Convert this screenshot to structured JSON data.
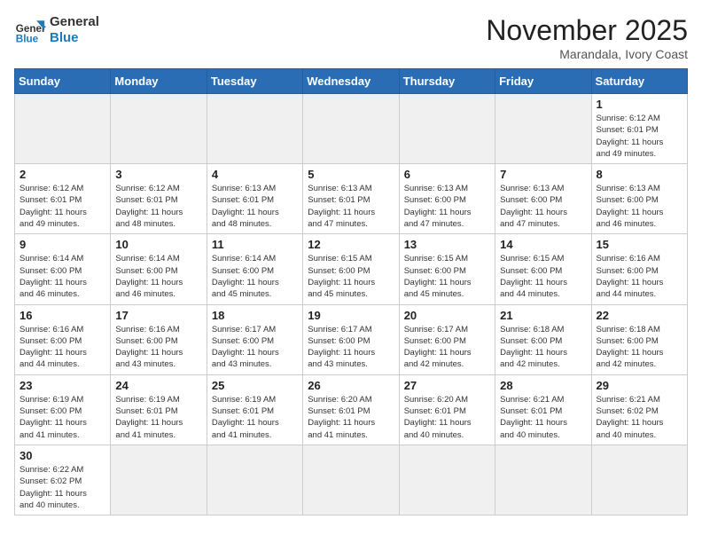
{
  "header": {
    "logo_general": "General",
    "logo_blue": "Blue",
    "month_title": "November 2025",
    "location": "Marandala, Ivory Coast"
  },
  "weekdays": [
    "Sunday",
    "Monday",
    "Tuesday",
    "Wednesday",
    "Thursday",
    "Friday",
    "Saturday"
  ],
  "weeks": [
    [
      {
        "day": "",
        "info": ""
      },
      {
        "day": "",
        "info": ""
      },
      {
        "day": "",
        "info": ""
      },
      {
        "day": "",
        "info": ""
      },
      {
        "day": "",
        "info": ""
      },
      {
        "day": "",
        "info": ""
      },
      {
        "day": "1",
        "info": "Sunrise: 6:12 AM\nSunset: 6:01 PM\nDaylight: 11 hours\nand 49 minutes."
      }
    ],
    [
      {
        "day": "2",
        "info": "Sunrise: 6:12 AM\nSunset: 6:01 PM\nDaylight: 11 hours\nand 49 minutes."
      },
      {
        "day": "3",
        "info": "Sunrise: 6:12 AM\nSunset: 6:01 PM\nDaylight: 11 hours\nand 48 minutes."
      },
      {
        "day": "4",
        "info": "Sunrise: 6:13 AM\nSunset: 6:01 PM\nDaylight: 11 hours\nand 48 minutes."
      },
      {
        "day": "5",
        "info": "Sunrise: 6:13 AM\nSunset: 6:01 PM\nDaylight: 11 hours\nand 47 minutes."
      },
      {
        "day": "6",
        "info": "Sunrise: 6:13 AM\nSunset: 6:00 PM\nDaylight: 11 hours\nand 47 minutes."
      },
      {
        "day": "7",
        "info": "Sunrise: 6:13 AM\nSunset: 6:00 PM\nDaylight: 11 hours\nand 47 minutes."
      },
      {
        "day": "8",
        "info": "Sunrise: 6:13 AM\nSunset: 6:00 PM\nDaylight: 11 hours\nand 46 minutes."
      }
    ],
    [
      {
        "day": "9",
        "info": "Sunrise: 6:14 AM\nSunset: 6:00 PM\nDaylight: 11 hours\nand 46 minutes."
      },
      {
        "day": "10",
        "info": "Sunrise: 6:14 AM\nSunset: 6:00 PM\nDaylight: 11 hours\nand 46 minutes."
      },
      {
        "day": "11",
        "info": "Sunrise: 6:14 AM\nSunset: 6:00 PM\nDaylight: 11 hours\nand 45 minutes."
      },
      {
        "day": "12",
        "info": "Sunrise: 6:15 AM\nSunset: 6:00 PM\nDaylight: 11 hours\nand 45 minutes."
      },
      {
        "day": "13",
        "info": "Sunrise: 6:15 AM\nSunset: 6:00 PM\nDaylight: 11 hours\nand 45 minutes."
      },
      {
        "day": "14",
        "info": "Sunrise: 6:15 AM\nSunset: 6:00 PM\nDaylight: 11 hours\nand 44 minutes."
      },
      {
        "day": "15",
        "info": "Sunrise: 6:16 AM\nSunset: 6:00 PM\nDaylight: 11 hours\nand 44 minutes."
      }
    ],
    [
      {
        "day": "16",
        "info": "Sunrise: 6:16 AM\nSunset: 6:00 PM\nDaylight: 11 hours\nand 44 minutes."
      },
      {
        "day": "17",
        "info": "Sunrise: 6:16 AM\nSunset: 6:00 PM\nDaylight: 11 hours\nand 43 minutes."
      },
      {
        "day": "18",
        "info": "Sunrise: 6:17 AM\nSunset: 6:00 PM\nDaylight: 11 hours\nand 43 minutes."
      },
      {
        "day": "19",
        "info": "Sunrise: 6:17 AM\nSunset: 6:00 PM\nDaylight: 11 hours\nand 43 minutes."
      },
      {
        "day": "20",
        "info": "Sunrise: 6:17 AM\nSunset: 6:00 PM\nDaylight: 11 hours\nand 42 minutes."
      },
      {
        "day": "21",
        "info": "Sunrise: 6:18 AM\nSunset: 6:00 PM\nDaylight: 11 hours\nand 42 minutes."
      },
      {
        "day": "22",
        "info": "Sunrise: 6:18 AM\nSunset: 6:00 PM\nDaylight: 11 hours\nand 42 minutes."
      }
    ],
    [
      {
        "day": "23",
        "info": "Sunrise: 6:19 AM\nSunset: 6:00 PM\nDaylight: 11 hours\nand 41 minutes."
      },
      {
        "day": "24",
        "info": "Sunrise: 6:19 AM\nSunset: 6:01 PM\nDaylight: 11 hours\nand 41 minutes."
      },
      {
        "day": "25",
        "info": "Sunrise: 6:19 AM\nSunset: 6:01 PM\nDaylight: 11 hours\nand 41 minutes."
      },
      {
        "day": "26",
        "info": "Sunrise: 6:20 AM\nSunset: 6:01 PM\nDaylight: 11 hours\nand 41 minutes."
      },
      {
        "day": "27",
        "info": "Sunrise: 6:20 AM\nSunset: 6:01 PM\nDaylight: 11 hours\nand 40 minutes."
      },
      {
        "day": "28",
        "info": "Sunrise: 6:21 AM\nSunset: 6:01 PM\nDaylight: 11 hours\nand 40 minutes."
      },
      {
        "day": "29",
        "info": "Sunrise: 6:21 AM\nSunset: 6:02 PM\nDaylight: 11 hours\nand 40 minutes."
      }
    ],
    [
      {
        "day": "30",
        "info": "Sunrise: 6:22 AM\nSunset: 6:02 PM\nDaylight: 11 hours\nand 40 minutes."
      },
      {
        "day": "",
        "info": ""
      },
      {
        "day": "",
        "info": ""
      },
      {
        "day": "",
        "info": ""
      },
      {
        "day": "",
        "info": ""
      },
      {
        "day": "",
        "info": ""
      },
      {
        "day": "",
        "info": ""
      }
    ]
  ]
}
